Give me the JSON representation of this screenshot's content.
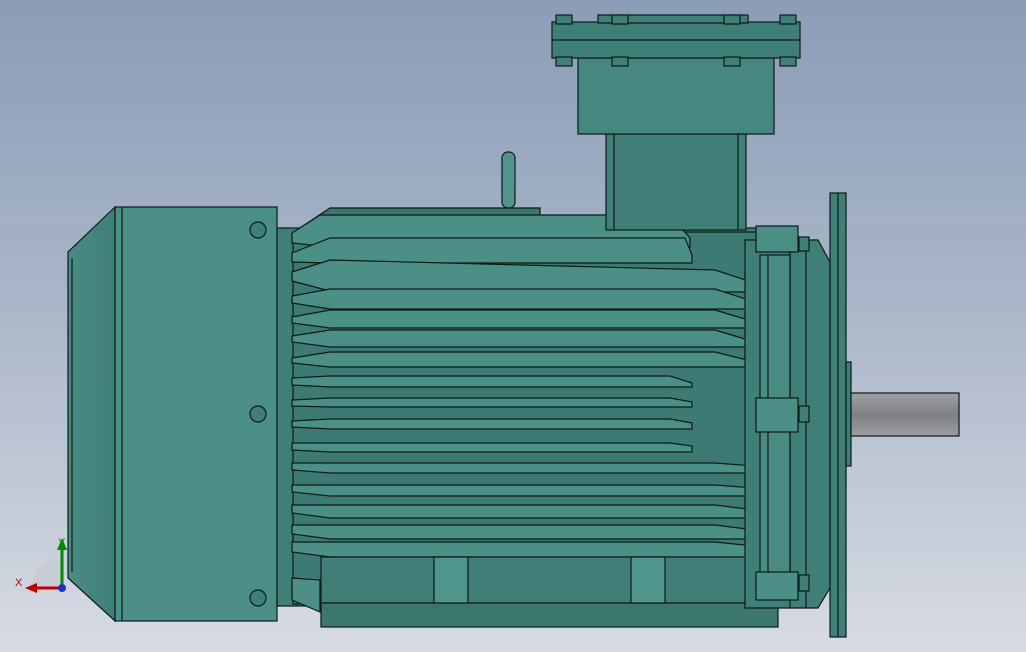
{
  "colors": {
    "background_top": "#8b9cb6",
    "background_bottom": "#d7dbe3",
    "body_main": "#3f7f77",
    "body_light": "#4f958c",
    "body_dark": "#2f6a63",
    "edge": "#0b1a18",
    "shaft": "#8d8f92",
    "axis_x": "#c00000",
    "axis_y": "#008c00",
    "axis_z": "#1f2fbf"
  },
  "triad": {
    "x_label": "X",
    "y_label": "Y"
  },
  "icons": [
    "coordinate-triad-icon"
  ]
}
